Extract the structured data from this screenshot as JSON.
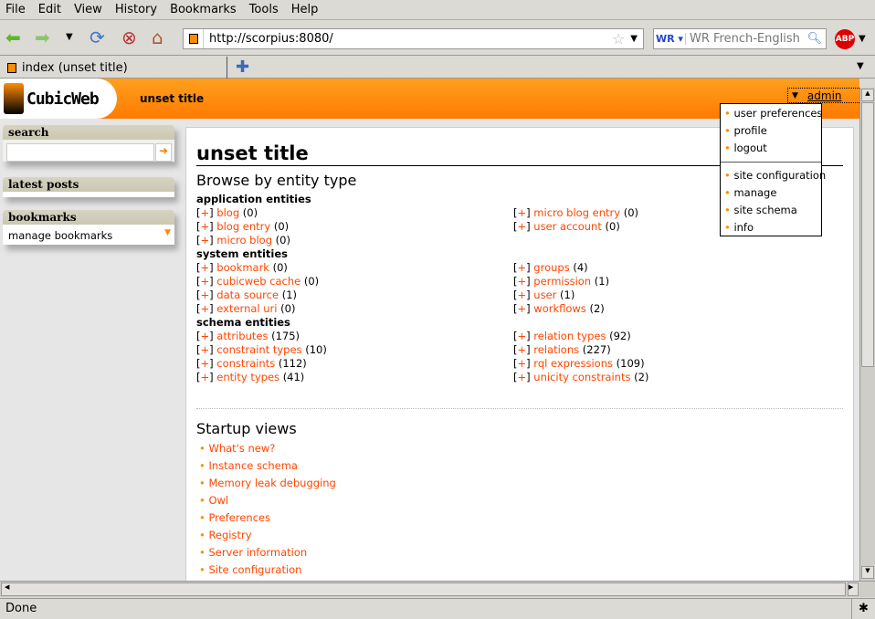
{
  "browser": {
    "menu": [
      "File",
      "Edit",
      "View",
      "History",
      "Bookmarks",
      "Tools",
      "Help"
    ],
    "url": "http://scorpius:8080/",
    "search_engine_placeholder": "WR French-English",
    "tab_title": "index (unset title)",
    "status": "Done"
  },
  "header": {
    "logo": "CubicWeb",
    "title": "unset title",
    "user": "admin"
  },
  "user_menu": {
    "items": [
      "user preferences",
      "profile",
      "logout"
    ],
    "admin_items": [
      "site configuration",
      "manage",
      "site schema",
      "info"
    ]
  },
  "sidebar": {
    "search_title": "search",
    "latest_posts_title": "latest posts",
    "bookmarks_title": "bookmarks",
    "manage_bookmarks": "manage bookmarks"
  },
  "main": {
    "title": "unset title",
    "browse_title": "Browse by entity type",
    "plus": "[+]",
    "sections": [
      {
        "title": "application entities",
        "left": [
          [
            "blog",
            "(0)"
          ],
          [
            "blog entry",
            "(0)"
          ],
          [
            "micro blog",
            "(0)"
          ]
        ],
        "right": [
          [
            "micro blog entry",
            "(0)"
          ],
          [
            "user account",
            "(0)"
          ]
        ]
      },
      {
        "title": "system entities",
        "left": [
          [
            "bookmark",
            "(0)"
          ],
          [
            "cubicweb cache",
            "(0)"
          ],
          [
            "data source",
            "(1)"
          ],
          [
            "external uri",
            "(0)"
          ]
        ],
        "right": [
          [
            "groups",
            "(4)"
          ],
          [
            "permission",
            "(1)"
          ],
          [
            "user",
            "(1)"
          ],
          [
            "workflows",
            "(2)"
          ]
        ]
      },
      {
        "title": "schema entities",
        "left": [
          [
            "attributes",
            "(175)"
          ],
          [
            "constraint types",
            "(10)"
          ],
          [
            "constraints",
            "(112)"
          ],
          [
            "entity types",
            "(41)"
          ]
        ],
        "right": [
          [
            "relation types",
            "(92)"
          ],
          [
            "relations",
            "(227)"
          ],
          [
            "rql expressions",
            "(109)"
          ],
          [
            "unicity constraints",
            "(2)"
          ]
        ]
      }
    ],
    "startup_title": "Startup views",
    "startup_views": [
      "What's new?",
      "Instance schema",
      "Memory leak debugging",
      "Owl",
      "Preferences",
      "Registry",
      "Server information",
      "Site configuration"
    ]
  },
  "colors": {
    "accent": "#ff7a00",
    "link": "#ff4500"
  }
}
